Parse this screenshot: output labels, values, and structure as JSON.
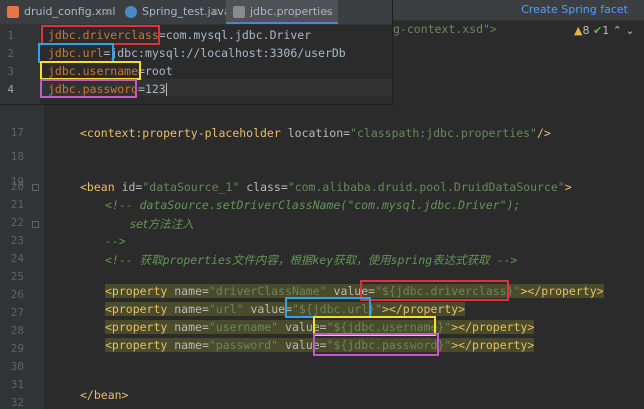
{
  "tabs": [
    {
      "label": "druid_config.xml",
      "active": false
    },
    {
      "label": "Spring_test.java",
      "active": false
    },
    {
      "label": "jdbc.properties",
      "active": true
    }
  ],
  "properties_editor": {
    "lines": [
      {
        "num": "1",
        "key": "jdbc.driverclass",
        "sep": "=",
        "value": "com.mysql.jdbc.Driver"
      },
      {
        "num": "2",
        "key": "jdbc.url",
        "sep": "=",
        "value": "jdbc:mysql://localhost:3306/userDb"
      },
      {
        "num": "3",
        "key": "jdbc.username",
        "sep": "=",
        "value": "root"
      },
      {
        "num": "4",
        "key": "jdbc.password",
        "sep": "=",
        "value": "123"
      }
    ]
  },
  "facet_link": "Create Spring facet",
  "xsd_fragment": {
    "text": "g-context.xsd\">"
  },
  "inspections": {
    "warnings": "8",
    "ok": "1"
  },
  "xml_editor": {
    "line_numbers": [
      "17",
      "18",
      "19",
      "20",
      "21",
      "22",
      "23",
      "24",
      "25",
      "26",
      "27",
      "28",
      "29",
      "30",
      "31",
      "32"
    ],
    "placeholder": {
      "tag": "<context:property-placeholder",
      "attr": "location=",
      "val": "\"classpath:jdbc.properties\"",
      "close": "/>"
    },
    "bean_open": {
      "tag": "<bean",
      "attr1": "id=",
      "val1": "\"dataSource_1\"",
      "attr2": "class=",
      "val2": "\"com.alibaba.druid.pool.DruidDataSource\"",
      "close": ">"
    },
    "comment1": "<!-- dataSource.setDriverClassName(\"com.mysql.jdbc.Driver\");",
    "comment2": "set方法注入",
    "comment3": "-->",
    "comment4": "<!-- 获取properties文件内容，根据key获取，使用spring表达式获取 -->",
    "properties": [
      {
        "name": "\"driverClassName\"",
        "value": "\"${jdbc.driverclass}\""
      },
      {
        "name": "\"url\"",
        "value": "\"${jdbc.url}\""
      },
      {
        "name": "\"username\"",
        "value": "\"${jdbc.username}\""
      },
      {
        "name": "\"password\"",
        "value": "\"${jdbc.password}\""
      }
    ],
    "prop_tag_open": "<property",
    "prop_name_attr": "name=",
    "prop_value_attr": "value=",
    "prop_close": "></property>",
    "bean_close": "</bean>"
  }
}
